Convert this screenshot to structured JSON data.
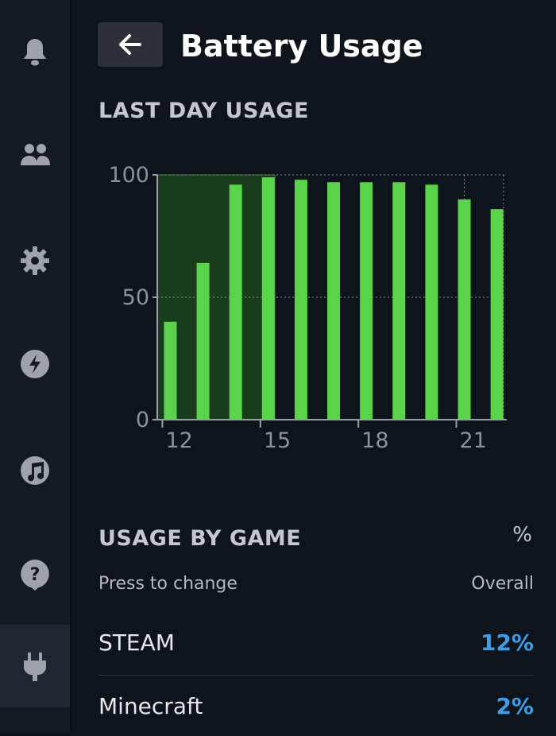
{
  "header": {
    "title": "Battery Usage"
  },
  "sidebar": {
    "items": [
      {
        "icon": "bell-icon"
      },
      {
        "icon": "friends-icon"
      },
      {
        "icon": "gear-icon"
      },
      {
        "icon": "lightning-icon"
      },
      {
        "icon": "music-icon"
      },
      {
        "icon": "help-icon"
      },
      {
        "icon": "power-plug-icon",
        "active": true
      }
    ]
  },
  "last_day": {
    "title": "LAST DAY USAGE"
  },
  "chart_data": {
    "type": "bar",
    "title": "LAST DAY USAGE",
    "x": [
      12,
      13,
      14,
      15,
      16,
      17,
      18,
      19,
      20,
      21,
      22
    ],
    "values": [
      40,
      64,
      96,
      99,
      98,
      97,
      97,
      97,
      96,
      90,
      86
    ],
    "xticks": [
      "12",
      "15",
      "18",
      "21"
    ],
    "yticks": [
      "0",
      "50",
      "100"
    ],
    "ylim": [
      0,
      100
    ],
    "bar_color": "#59d34a",
    "highlight_color": "#1e4a1e"
  },
  "usage_by_game": {
    "title": "USAGE BY GAME",
    "unit_label": "%",
    "press_label": "Press to change",
    "mode_label": "Overall",
    "games": [
      {
        "name": "STEAM",
        "value": "12%"
      },
      {
        "name": "Minecraft",
        "value": "2%"
      }
    ]
  },
  "colors": {
    "accent": "#3d9de9",
    "bar": "#59d34a"
  }
}
